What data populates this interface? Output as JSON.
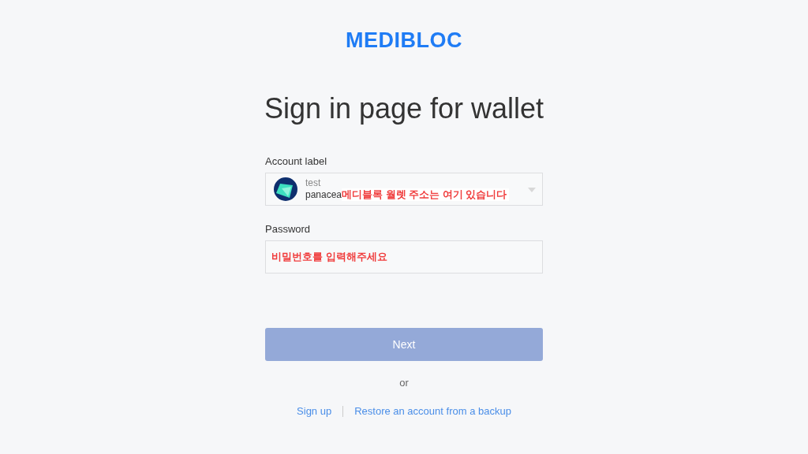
{
  "logo": "MEDIBLOC",
  "title": "Sign in page for wallet",
  "account": {
    "label": "Account label",
    "name": "test",
    "address": "panacea",
    "annotation": "메디블록 월렛 주소는 여기 있습니다"
  },
  "password": {
    "label": "Password",
    "annotation": "비밀번호를 입력해주세요"
  },
  "next_button": {
    "label": "Next",
    "disabled": true
  },
  "separator": "or",
  "links": [
    {
      "label": "Sign up"
    },
    {
      "label": "Restore an account from a backup"
    }
  ]
}
